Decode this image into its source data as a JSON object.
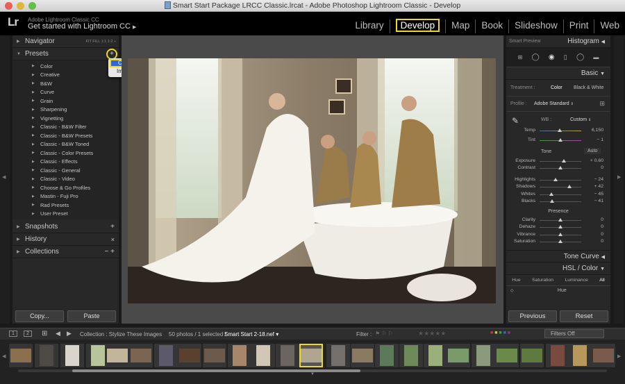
{
  "window": {
    "title": "Smart Start Package LRCC Classic.lrcat - Adobe Photoshop Lightroom Classic - Develop"
  },
  "identity": {
    "small": "Adobe Lightroom Classic CC",
    "main": "Get started with Lightroom CC",
    "logo": "Lr"
  },
  "modules": [
    "Library",
    "Develop",
    "Map",
    "Book",
    "Slideshow",
    "Print",
    "Web"
  ],
  "left_panel": {
    "navigator": {
      "label": "Navigator",
      "options": "FIT  FILL  1:1  1:2 ÷"
    },
    "presets": {
      "label": "Presets",
      "items": [
        "Color",
        "Creative",
        "B&W",
        "Curve",
        "Grain",
        "Sharpening",
        "Vignetting",
        "Classic - B&W Filter",
        "Classic - B&W Presets",
        "Classic - B&W Toned",
        "Classic - Color Presets",
        "Classic - Effects",
        "Classic - General",
        "Classic - Video",
        "Choose & Go Profiles",
        "Mastin - Fuji Pro",
        "Rad Presets",
        "User Preset"
      ]
    },
    "context_menu": [
      "Create Preset...",
      "Import Preset(s)..."
    ],
    "snapshots": "Snapshots",
    "history": "History",
    "collections": "Collections",
    "copy_button": "Copy...",
    "paste_button": "Paste"
  },
  "right_panel": {
    "smart_preview": "Smart Preview",
    "histogram": "Histogram",
    "basic": "Basic",
    "treatment": {
      "label": "Treatment :",
      "color": "Color",
      "bw": "Black & White"
    },
    "profile": {
      "label": "Profile :",
      "value": "Adobe Standard"
    },
    "wb": {
      "label": "WB :",
      "value": "Custom"
    },
    "temp": {
      "label": "Temp",
      "value": "6,150"
    },
    "tint": {
      "label": "Tint",
      "value": "− 1"
    },
    "tone": {
      "label": "Tone",
      "auto": "Auto"
    },
    "sliders": [
      {
        "label": "Exposure",
        "value": "+ 0.60"
      },
      {
        "label": "Contrast",
        "value": "0"
      },
      {
        "label": "Highlights",
        "value": "− 24"
      },
      {
        "label": "Shadows",
        "value": "+ 42"
      },
      {
        "label": "Whites",
        "value": "− 45"
      },
      {
        "label": "Blacks",
        "value": "− 41"
      }
    ],
    "presence": {
      "label": "Presence"
    },
    "presence_sliders": [
      {
        "label": "Clarity",
        "value": "0"
      },
      {
        "label": "Dehaze",
        "value": "0"
      },
      {
        "label": "Vibrance",
        "value": "0"
      },
      {
        "label": "Saturation",
        "value": "0"
      }
    ],
    "tone_curve": "Tone Curve",
    "hsl": {
      "label": "HSL / Color",
      "tabs": [
        "Hue",
        "Saturation",
        "Luminance",
        "All"
      ],
      "sub": "Hue"
    },
    "previous_button": "Previous",
    "reset_button": "Reset"
  },
  "filmstrip": {
    "screens": [
      "1",
      "2"
    ],
    "collection": "Collection : Stylize These Images",
    "count": "50 photos / 1 selected /",
    "filename": "Smart Start 2-18.nef",
    "filter_label": "Filter :",
    "filters_off": "Filters Off"
  },
  "colors": {
    "accent_highlight": "#f1d81b",
    "selected_menu": "#2f68d6",
    "panel": "#282828",
    "background": "#1a1a1a"
  }
}
